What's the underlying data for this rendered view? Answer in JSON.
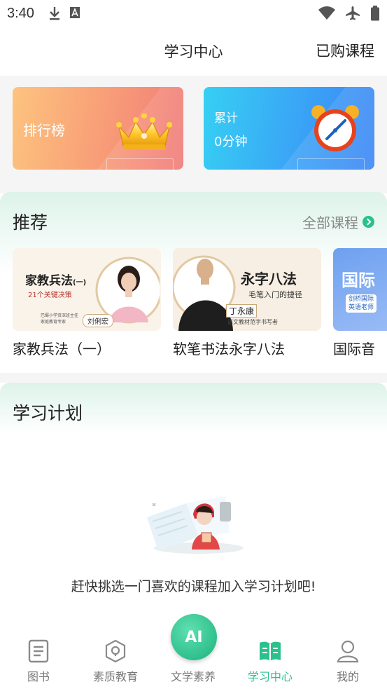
{
  "status_bar": {
    "time": "3:40"
  },
  "header": {
    "title": "学习中心",
    "purchased": "已购课程"
  },
  "cards": {
    "rank_label": "排行榜",
    "total_label": "累计",
    "total_value": "0分钟"
  },
  "recommend": {
    "title": "推荐",
    "all_courses": "全部课程",
    "courses": [
      {
        "name": "家教兵法（一）",
        "thumb_title": "家教兵法",
        "thumb_sub": "(一)",
        "thumb_tagline": "21个关键决策",
        "thumb_note1": "巴蜀小学资深班主任",
        "thumb_note2": "家庭教育专家",
        "thumb_author": "刘俐宏"
      },
      {
        "name": "软笔书法永字八法",
        "thumb_title": "永字八法",
        "thumb_tagline": "毛笔入门的捷径",
        "thumb_author": "丁永康",
        "thumb_note1": "语文教材范字书写者"
      },
      {
        "name": "国际音",
        "thumb_title": "国际",
        "thumb_note1": "剑桥国际",
        "thumb_note2": "英语老师"
      }
    ]
  },
  "plan": {
    "title": "学习计划",
    "empty_text": "赶快挑选一门喜欢的课程加入学习计划吧!"
  },
  "tabs": [
    {
      "label": "图书",
      "icon": "book-icon"
    },
    {
      "label": "素质教育",
      "icon": "quality-education-icon"
    },
    {
      "label": "文学素养",
      "icon": "ai-icon",
      "ai_text": "AI"
    },
    {
      "label": "学习中心",
      "icon": "study-center-icon"
    },
    {
      "label": "我的",
      "icon": "profile-icon"
    }
  ],
  "colors": {
    "accent": "#2bc18d",
    "rank_card": "#f07a79",
    "total_card": "#3b86f5"
  }
}
